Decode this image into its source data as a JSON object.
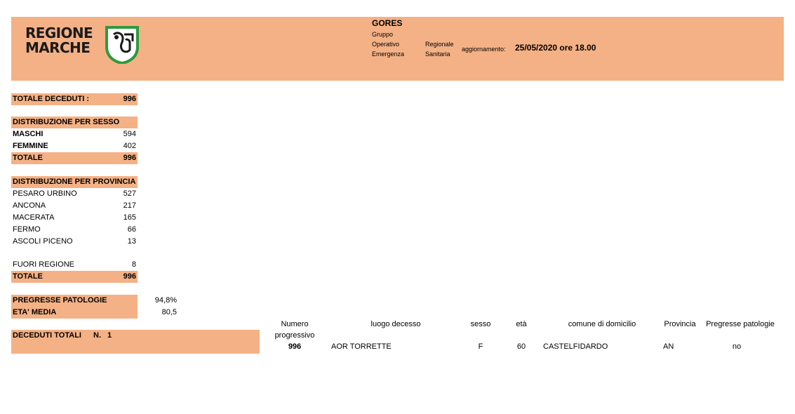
{
  "header": {
    "logo_line1": "REGIONE",
    "logo_line2": "MARCHE",
    "title": "GORES",
    "col1": [
      "Gruppo",
      "Operativo",
      "Emergenza"
    ],
    "col2": [
      "Regionale",
      "Sanitaria"
    ],
    "update_label": "aggiornamento:",
    "update_date": "25/05/2020 ore 18.00"
  },
  "totale_deceduti": {
    "label": "TOTALE DECEDUTI :",
    "value": "996"
  },
  "sesso": {
    "title": "DISTRIBUZIONE PER SESSO",
    "maschi_label": "MASCHI",
    "maschi_value": "594",
    "femmine_label": "FEMMINE",
    "femmine_value": "402",
    "totale_label": "TOTALE",
    "totale_value": "996"
  },
  "provincia": {
    "title": "DISTRIBUZIONE PER PROVINCIA",
    "rows": [
      {
        "label": "PESARO URBINO",
        "value": "527"
      },
      {
        "label": "ANCONA",
        "value": "217"
      },
      {
        "label": "MACERATA",
        "value": "165"
      },
      {
        "label": "FERMO",
        "value": "66"
      },
      {
        "label": "ASCOLI PICENO",
        "value": "13"
      }
    ],
    "fuori_label": "FUORI REGIONE",
    "fuori_value": "8",
    "totale_label": "TOTALE",
    "totale_value": "996"
  },
  "stats": {
    "patologie_label": "PREGRESSE PATOLOGIE",
    "patologie_value": "94,8%",
    "eta_label": "ETA' MEDIA",
    "eta_value": "80,5"
  },
  "deceduti_totali": {
    "label": "DECEDUTI TOTALI",
    "n_label": "N.",
    "n_value": "1"
  },
  "table": {
    "headers": {
      "numero_line1": "Numero",
      "numero_line2": "progressivo",
      "luogo": "luogo decesso",
      "sesso": "sesso",
      "eta": "età",
      "comune": "comune di domicilio",
      "provincia": "Provincia",
      "patologie": "Pregresse patologie"
    },
    "row": {
      "numero": "996",
      "luogo": "AOR TORRETTE",
      "sesso": "F",
      "eta": "60",
      "comune": "CASTELFIDARDO",
      "provincia": "AN",
      "patologie": "no"
    }
  },
  "colors": {
    "band": "#f4b185",
    "logo_green": "#2f9a3c"
  },
  "icons": {
    "logo": "regione-marche-shield-icon"
  }
}
